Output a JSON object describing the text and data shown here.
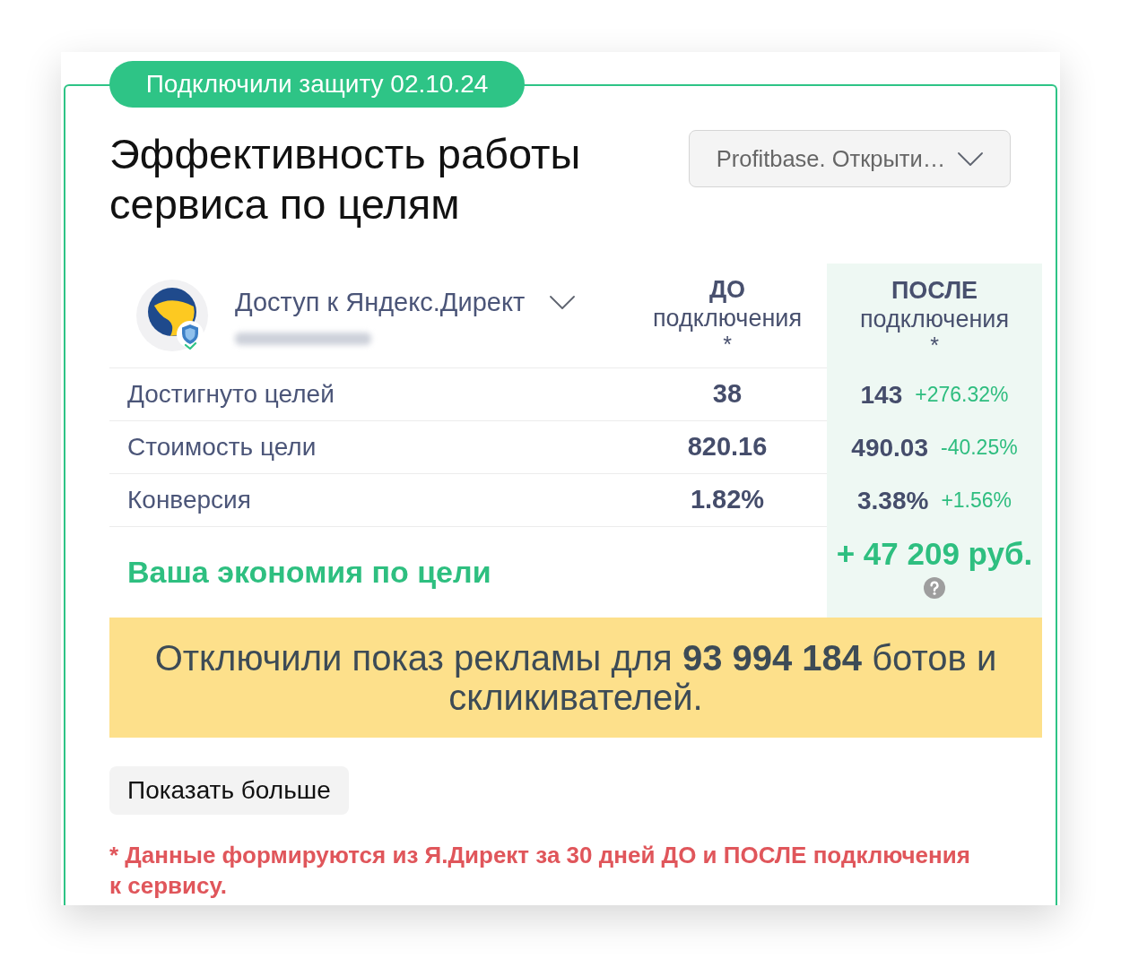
{
  "badge": "Подключили защиту 02.10.24",
  "title": "Эффективность работы сервиса по целям",
  "goal_select": {
    "value": "Profitbase. Открыти…"
  },
  "account": {
    "name": "Доступ к Яндекс.Директ"
  },
  "columns": [
    {
      "title": "ДО",
      "subtitle": "подключения",
      "mark": "*",
      "highlighted": false
    },
    {
      "title": "ПОСЛЕ",
      "subtitle": "подключения",
      "mark": "*",
      "highlighted": true
    }
  ],
  "rows": [
    {
      "label": "Достигнуто целей",
      "before": "38",
      "after": "143",
      "change": "+276.32%"
    },
    {
      "label": "Стоимость цели",
      "before": "820.16",
      "after": "490.03",
      "change": "-40.25%"
    },
    {
      "label": "Конверсия",
      "before": "1.82%",
      "after": "3.38%",
      "change": "+1.56%"
    }
  ],
  "savings": {
    "label": "Ваша экономия по цели",
    "value": "+ 47 209 руб."
  },
  "banner": {
    "text": "Отключили показ рекламы для **93 994 184** ботов и скликивателей."
  },
  "show_more_button": "Показать больше",
  "footnote": "* Данные формируются из Я.Директ за 30 дней ДО и ПОСЛЕ подключения к сервису."
}
